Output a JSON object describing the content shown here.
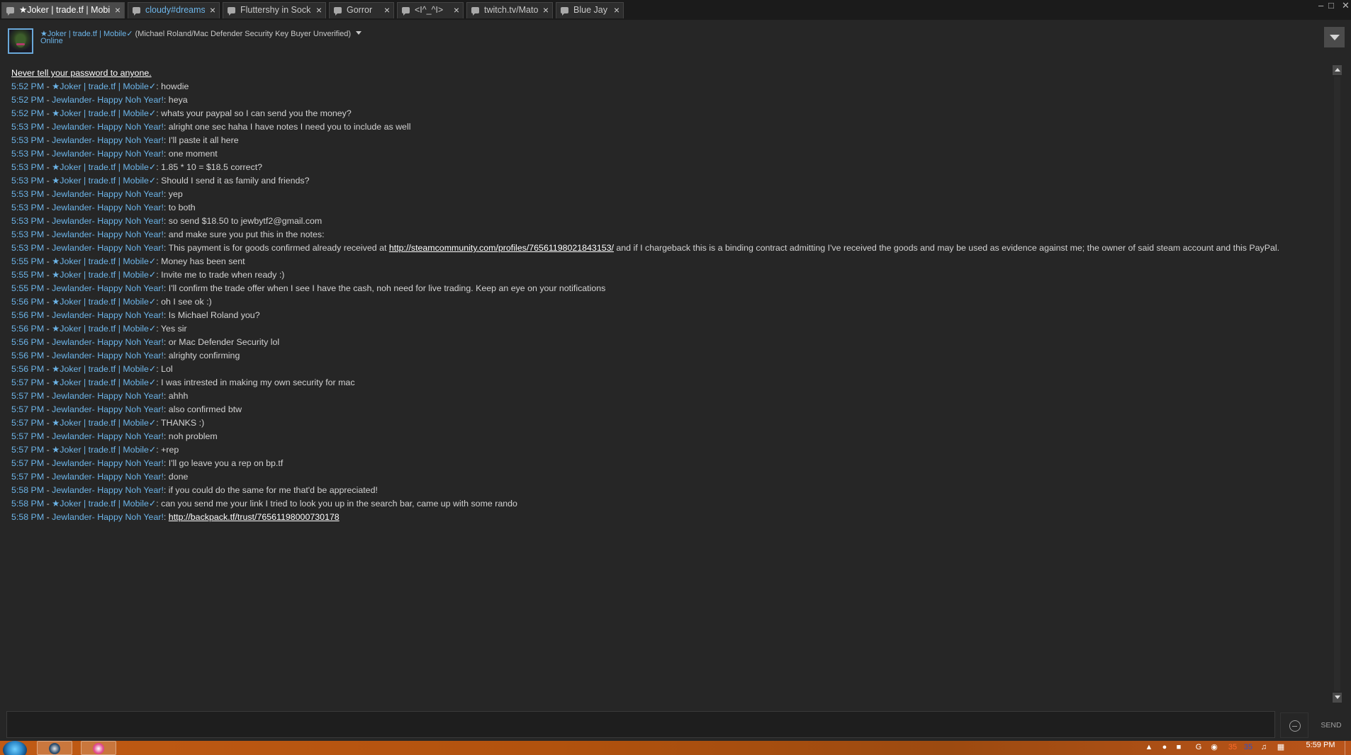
{
  "tabs": [
    {
      "label": "★Joker | trade.tf | Mobile✓",
      "close": "×"
    },
    {
      "label": "cloudy#dreamset",
      "close": "×"
    },
    {
      "label": "Fluttershy in Sockies",
      "close": "×"
    },
    {
      "label": "Gorror",
      "close": "×"
    },
    {
      "label": "<I^_^I>",
      "close": "×"
    },
    {
      "label": "twitch.tv/Mato «",
      "close": "×"
    },
    {
      "label": "Blue Jay",
      "close": "×"
    }
  ],
  "window_controls": {
    "minimize": "–",
    "maximize": "□",
    "close": "✕"
  },
  "header": {
    "name": "★Joker | trade.tf | Mobile✓",
    "name_extra": " (Michael Roland/Mac Defender Security Key Buyer Unverified)",
    "status": "Online"
  },
  "chat": {
    "warning": "Never tell your password to anyone.",
    "messages": [
      {
        "time": "5:52 PM",
        "sender": "★Joker | trade.tf | Mobile✓",
        "text": "howdie"
      },
      {
        "time": "5:52 PM",
        "sender": "Jewlander- Happy Noh Year!",
        "text": "heya"
      },
      {
        "time": "5:52 PM",
        "sender": "★Joker | trade.tf | Mobile✓",
        "text": "whats your paypal so I can send you the money?"
      },
      {
        "time": "5:53 PM",
        "sender": "Jewlander- Happy Noh Year!",
        "text": "alright one sec haha I have notes I need you to include as well"
      },
      {
        "time": "5:53 PM",
        "sender": "Jewlander- Happy Noh Year!",
        "text": "I'll paste it all here"
      },
      {
        "time": "5:53 PM",
        "sender": "Jewlander- Happy Noh Year!",
        "text": "one moment"
      },
      {
        "time": "5:53 PM",
        "sender": "★Joker | trade.tf | Mobile✓",
        "text": "1.85 * 10 = $18.5 correct?"
      },
      {
        "time": "5:53 PM",
        "sender": "★Joker | trade.tf | Mobile✓",
        "text": "Should I send it as family and friends?"
      },
      {
        "time": "5:53 PM",
        "sender": "Jewlander- Happy Noh Year!",
        "text": "yep"
      },
      {
        "time": "5:53 PM",
        "sender": "Jewlander- Happy Noh Year!",
        "text": "to both"
      },
      {
        "time": "5:53 PM",
        "sender": "Jewlander- Happy Noh Year!",
        "text": "so send $18.50 to jewbytf2@gmail.com"
      },
      {
        "time": "5:53 PM",
        "sender": "Jewlander- Happy Noh Year!",
        "text": "and make sure you put this in the notes:"
      },
      {
        "time": "5:53 PM",
        "sender": "Jewlander- Happy Noh Year!",
        "text_before": "This payment is for goods confirmed already received at ",
        "link": "http://steamcommunity.com/profiles/76561198021843153/",
        "text_after": " and if I chargeback this is a binding contract admitting I've received the goods and may be used as evidence against me; the owner of said steam account and this PayPal."
      },
      {
        "time": "5:55 PM",
        "sender": "★Joker | trade.tf | Mobile✓",
        "text": "Money has been sent"
      },
      {
        "time": "5:55 PM",
        "sender": "★Joker | trade.tf | Mobile✓",
        "text": "Invite me to trade when ready :)"
      },
      {
        "time": "5:55 PM",
        "sender": "Jewlander- Happy Noh Year!",
        "text": "I'll confirm the trade offer when I see I have the cash, noh need for live trading. Keep an eye on your notifications"
      },
      {
        "time": "5:56 PM",
        "sender": "★Joker | trade.tf | Mobile✓",
        "text": "oh I see ok :)"
      },
      {
        "time": "5:56 PM",
        "sender": "Jewlander- Happy Noh Year!",
        "text": "Is Michael Roland you?"
      },
      {
        "time": "5:56 PM",
        "sender": "★Joker | trade.tf | Mobile✓",
        "text": "Yes sir"
      },
      {
        "time": "5:56 PM",
        "sender": "Jewlander- Happy Noh Year!",
        "text": "or Mac Defender Security lol"
      },
      {
        "time": "5:56 PM",
        "sender": "Jewlander- Happy Noh Year!",
        "text": "alrighty confirming"
      },
      {
        "time": "5:56 PM",
        "sender": "★Joker | trade.tf | Mobile✓",
        "text": "Lol"
      },
      {
        "time": "5:57 PM",
        "sender": "★Joker | trade.tf | Mobile✓",
        "text": "I was intrested in making my own security for mac"
      },
      {
        "time": "5:57 PM",
        "sender": "Jewlander- Happy Noh Year!",
        "text": "ahhh"
      },
      {
        "time": "5:57 PM",
        "sender": "Jewlander- Happy Noh Year!",
        "text": "also confirmed btw"
      },
      {
        "time": "5:57 PM",
        "sender": "★Joker | trade.tf | Mobile✓",
        "text": "THANKS :)"
      },
      {
        "time": "5:57 PM",
        "sender": "Jewlander- Happy Noh Year!",
        "text": "noh problem"
      },
      {
        "time": "5:57 PM",
        "sender": "★Joker | trade.tf | Mobile✓",
        "text": "+rep"
      },
      {
        "time": "5:57 PM",
        "sender": "Jewlander- Happy Noh Year!",
        "text": "I'll go leave you a rep on bp.tf"
      },
      {
        "time": "5:57 PM",
        "sender": "Jewlander- Happy Noh Year!",
        "text": "done"
      },
      {
        "time": "5:58 PM",
        "sender": "Jewlander- Happy Noh Year!",
        "text": "if you could do the same for me that'd be appreciated!"
      },
      {
        "time": "5:58 PM",
        "sender": "★Joker | trade.tf | Mobile✓",
        "text": "can you send me your link I tried to look you up in the search bar, came up with some rando"
      },
      {
        "time": "5:58 PM",
        "sender": "Jewlander- Happy Noh Year!",
        "text_before": "",
        "link": "http://backpack.tf/trust/76561198000730178",
        "text_after": ""
      }
    ]
  },
  "input": {
    "send_label": "SEND",
    "emoticon_icon": "smiley-icon"
  },
  "taskbar": {
    "clock_time": "5:59 PM",
    "tray_numbers": [
      "35",
      "35"
    ],
    "icons": [
      "start-orb-icon",
      "steam-icon",
      "itunes-icon"
    ]
  },
  "colors": {
    "background": "#262626",
    "tabbar": "#1b1b1b",
    "accent_blue": "#6cb4e8",
    "text": "#d2d2d2",
    "taskbar_orange": "#b2520e"
  }
}
